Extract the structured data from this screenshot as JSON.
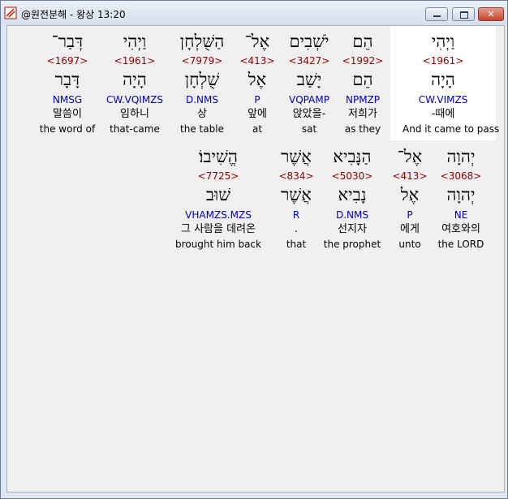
{
  "window": {
    "title": "@원전분해 - 왕상 13:20",
    "close_glyph": "✕"
  },
  "rows": [
    {
      "words": [
        {
          "hebrew": "וַיְהִי",
          "strong": "<1961>",
          "lemma": "הָיָה",
          "parse": "CW.VIMZS",
          "korean": "-때에",
          "english": "And it came to pass",
          "selected": true
        },
        {
          "hebrew": "הֵם",
          "strong": "<1992>",
          "lemma": "הֵם",
          "parse": "NPMZP",
          "korean": "저희가",
          "english": "as they"
        },
        {
          "hebrew": "יֹשְׁבִים",
          "strong": "<3427>",
          "lemma": "יָשַׁב",
          "parse": "VQPAMP",
          "korean": "앉았을-",
          "english": "sat"
        },
        {
          "hebrew": "אֶל־",
          "strong": "<413>",
          "lemma": "אֶל",
          "parse": "P",
          "korean": "앞에",
          "english": "at"
        },
        {
          "hebrew": "הַשֻּׁלְחָן",
          "strong": "<7979>",
          "lemma": "שֻׁלְחָן",
          "parse": "D.NMS",
          "korean": "상",
          "english": "the table"
        },
        {
          "hebrew": "וַיְהִי",
          "strong": "<1961>",
          "lemma": "הָיָה",
          "parse": "CW.VQIMZS",
          "korean": "임하니",
          "english": "that-came"
        },
        {
          "hebrew": "דְּבַר־",
          "strong": "<1697>",
          "lemma": "דָּבָר",
          "parse": "NMSG",
          "korean": "말씀이",
          "english": "the word of"
        }
      ]
    },
    {
      "words": [
        {
          "hebrew": "יְהוָה",
          "strong": "<3068>",
          "lemma": "יְהוָה",
          "parse": "NE",
          "korean": "여호와의",
          "english": "the LORD"
        },
        {
          "hebrew": "אֶל־",
          "strong": "<413>",
          "lemma": "אֶל",
          "parse": "P",
          "korean": "에게",
          "english": "unto"
        },
        {
          "hebrew": "הַנָּבִיא",
          "strong": "<5030>",
          "lemma": "נָבִיא",
          "parse": "D.NMS",
          "korean": "선지자",
          "english": "the prophet"
        },
        {
          "hebrew": "אֲשֶׁר",
          "strong": "<834>",
          "lemma": "אֲשֶׁר",
          "parse": "R",
          "korean": ".",
          "english": "that"
        },
        {
          "hebrew": "הֱשִׁיבוֹ׃",
          "strong": "<7725>",
          "lemma": "שׁוּב",
          "parse": "VHAMZS.MZS",
          "korean": "그 사람을 데려온",
          "english": "brought him back"
        }
      ]
    }
  ]
}
